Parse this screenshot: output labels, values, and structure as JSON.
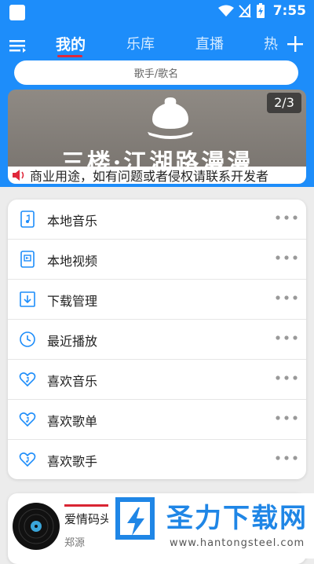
{
  "status_bar": {
    "time": "7:55"
  },
  "tabs": [
    {
      "label": "我的",
      "active": true
    },
    {
      "label": "乐库",
      "active": false
    },
    {
      "label": "直播",
      "active": false
    },
    {
      "label": "热",
      "active": false
    }
  ],
  "search": {
    "placeholder": "歌手/歌名"
  },
  "banner": {
    "title": "三楼·江湖路漫漫",
    "counter": "2/3",
    "notice": "商业用途，如有问题或者侵权请联系开发者"
  },
  "menu": [
    {
      "label": "本地音乐",
      "icon": "music-file-icon"
    },
    {
      "label": "本地视频",
      "icon": "video-file-icon"
    },
    {
      "label": "下载管理",
      "icon": "download-icon"
    },
    {
      "label": "最近播放",
      "icon": "clock-icon"
    },
    {
      "label": "喜欢音乐",
      "icon": "heart-music-icon"
    },
    {
      "label": "喜欢歌单",
      "icon": "heart-music-icon"
    },
    {
      "label": "喜欢歌手",
      "icon": "heart-music-icon"
    }
  ],
  "player": {
    "title": "爱情码头",
    "artist": "郑源"
  },
  "watermark": {
    "text": "圣力下载网",
    "url": "www.hantongsteel.com"
  },
  "colors": {
    "primary": "#1d8dfa",
    "accent": "#e0283b"
  }
}
